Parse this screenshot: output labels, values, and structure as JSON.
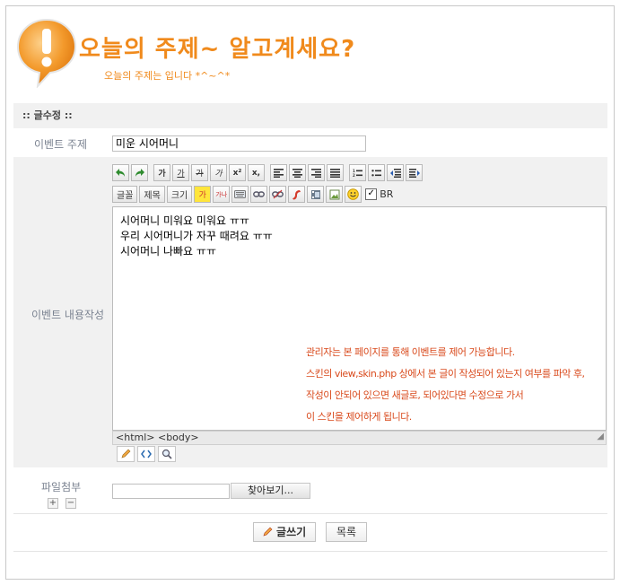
{
  "header": {
    "title": "오늘의 주제~ 알고계세요?",
    "subtitle": "오늘의 주제는 입니다 *^~^*"
  },
  "section": {
    "title": ":: 글수정 ::"
  },
  "form": {
    "subject_label": "이벤트 주제",
    "subject_value": "미운 시어머니",
    "content_label": "이벤트 내용작성",
    "file_label": "파일첨부",
    "browse_label": "찾아보기..."
  },
  "toolbar": {
    "font_label": "글꼴",
    "title_label": "제목",
    "size_label": "크기",
    "bold_label": "가",
    "underline_label": "가",
    "strike_label": "가",
    "italic_label": "가",
    "sup_label": "x²",
    "sub_label": "x,",
    "br_label": "BR",
    "highlight_label": "가",
    "bgcolor_label": "가나"
  },
  "editor": {
    "lines": [
      "시어머니 미워요 미워요 ㅠㅠ",
      "우리 시어머니가 자꾸 때려요 ㅠㅠ",
      "시어머니 나빠요 ㅠㅠ"
    ],
    "notice": [
      "관리자는 본 페이지를 통해 이벤트를 제어 가능합니다.",
      "스킨의 view,skin.php 상에서 본 글이 작성되어 있는지 여부를 파악 후,",
      "작성이 안되어 있으면 새글로, 되어있다면 수정으로 가서",
      "이 스킨을 제어하게 됩니다."
    ],
    "status_path": "<html> <body>"
  },
  "actions": {
    "write_label": "글쓰기",
    "list_label": "목록"
  },
  "colors": {
    "accent": "#f08a1c",
    "notice": "#d94a1c"
  }
}
